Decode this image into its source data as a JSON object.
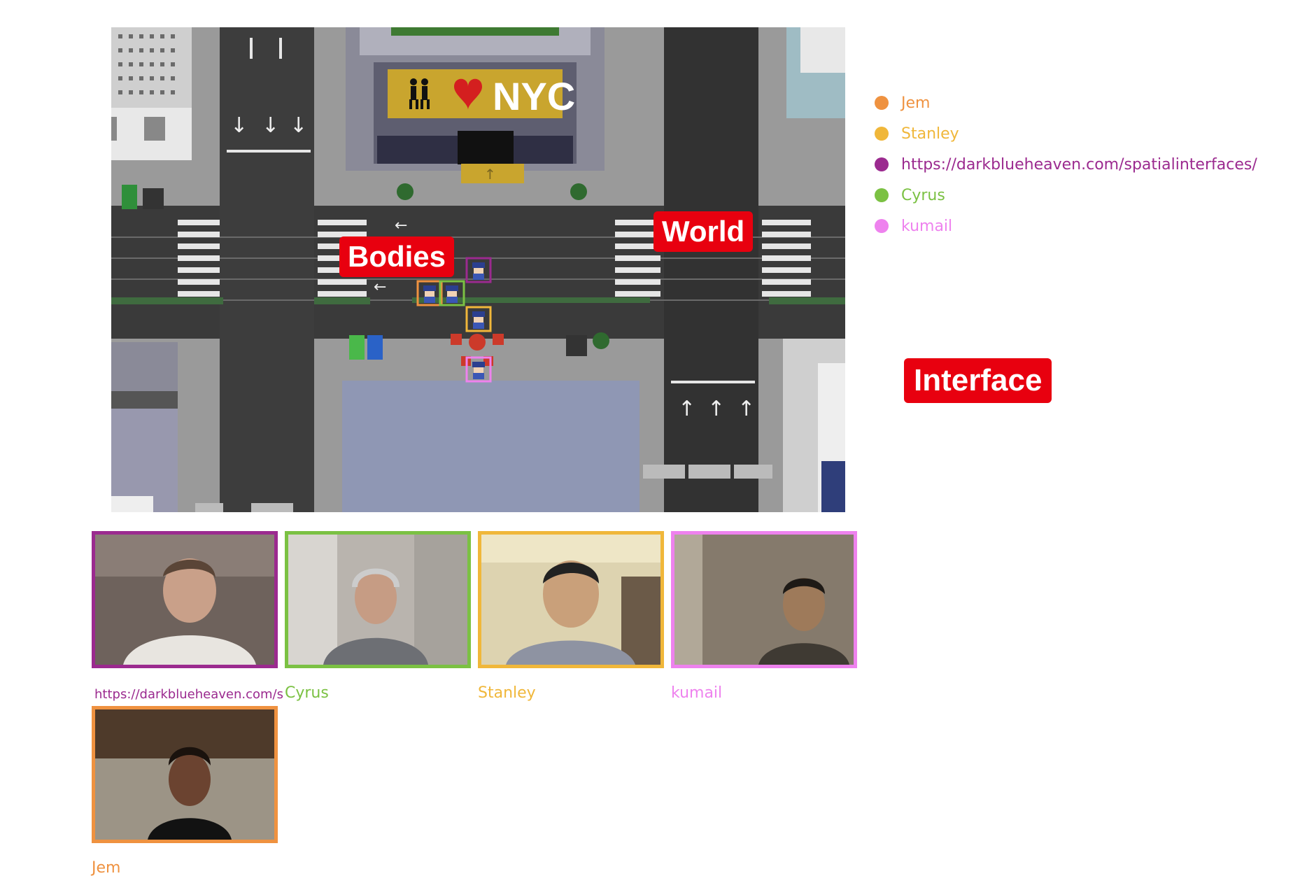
{
  "map": {
    "sign_text": "NYC",
    "avatars": [
      {
        "user": "https://darkblueheaven.com/spatialinterfaces/",
        "color": "#9b2a8f"
      },
      {
        "user": "Jem",
        "color": "#ef9240"
      },
      {
        "user": "Cyrus",
        "color": "#7bc143"
      },
      {
        "user": "Stanley",
        "color": "#f0b73a"
      },
      {
        "user": "kumail",
        "color": "#ee82ee"
      }
    ]
  },
  "annotations": {
    "bodies": "Bodies",
    "world": "World",
    "interface": "Interface"
  },
  "legend": {
    "items": [
      {
        "name": "Jem",
        "color": "#ef9240"
      },
      {
        "name": "Stanley",
        "color": "#f0b73a"
      },
      {
        "name": "https://darkblueheaven.com/spatialinterfaces/",
        "color": "#9b2a8f"
      },
      {
        "name": "Cyrus",
        "color": "#7bc143"
      },
      {
        "name": "kumail",
        "color": "#ee82ee"
      }
    ]
  },
  "video_tiles": [
    {
      "label": "https://darkblueheaven.com/s",
      "color": "#9b2a8f"
    },
    {
      "label": "Cyrus",
      "color": "#7bc143"
    },
    {
      "label": "Stanley",
      "color": "#f0b73a"
    },
    {
      "label": "kumail",
      "color": "#ee82ee"
    },
    {
      "label": "Jem",
      "color": "#ef9240"
    }
  ]
}
